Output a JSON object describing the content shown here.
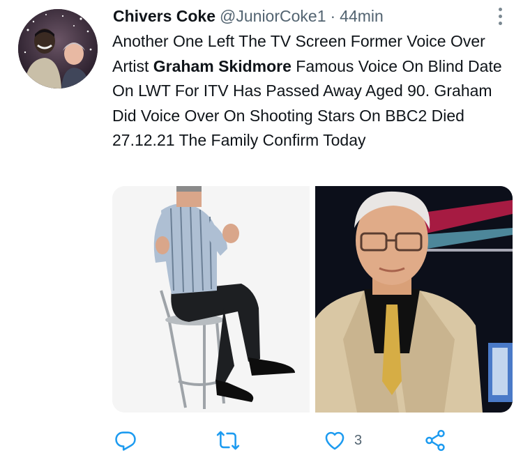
{
  "tweet": {
    "author_name": "Chivers Coke",
    "handle": "@JuniorCoke1",
    "separator": "·",
    "time": "44min",
    "text_part1": "Another One Left The TV Screen Former Voice Over Artist ",
    "text_bold": "Graham Skidmore",
    "text_part2": " Famous Voice On Blind Date On LWT For ITV Has Passed Away Aged 90. Graham Did Voice Over On Shooting Stars On BBC2 Died 27.12.21 The Family Confirm Today"
  },
  "actions": {
    "reply_icon": "reply-icon",
    "retweet_icon": "retweet-icon",
    "like_icon": "heart-icon",
    "like_count": "3",
    "share_icon": "share-icon"
  },
  "colors": {
    "text": "#0f1419",
    "secondary": "#536471",
    "icon": "#1d9bf0"
  }
}
